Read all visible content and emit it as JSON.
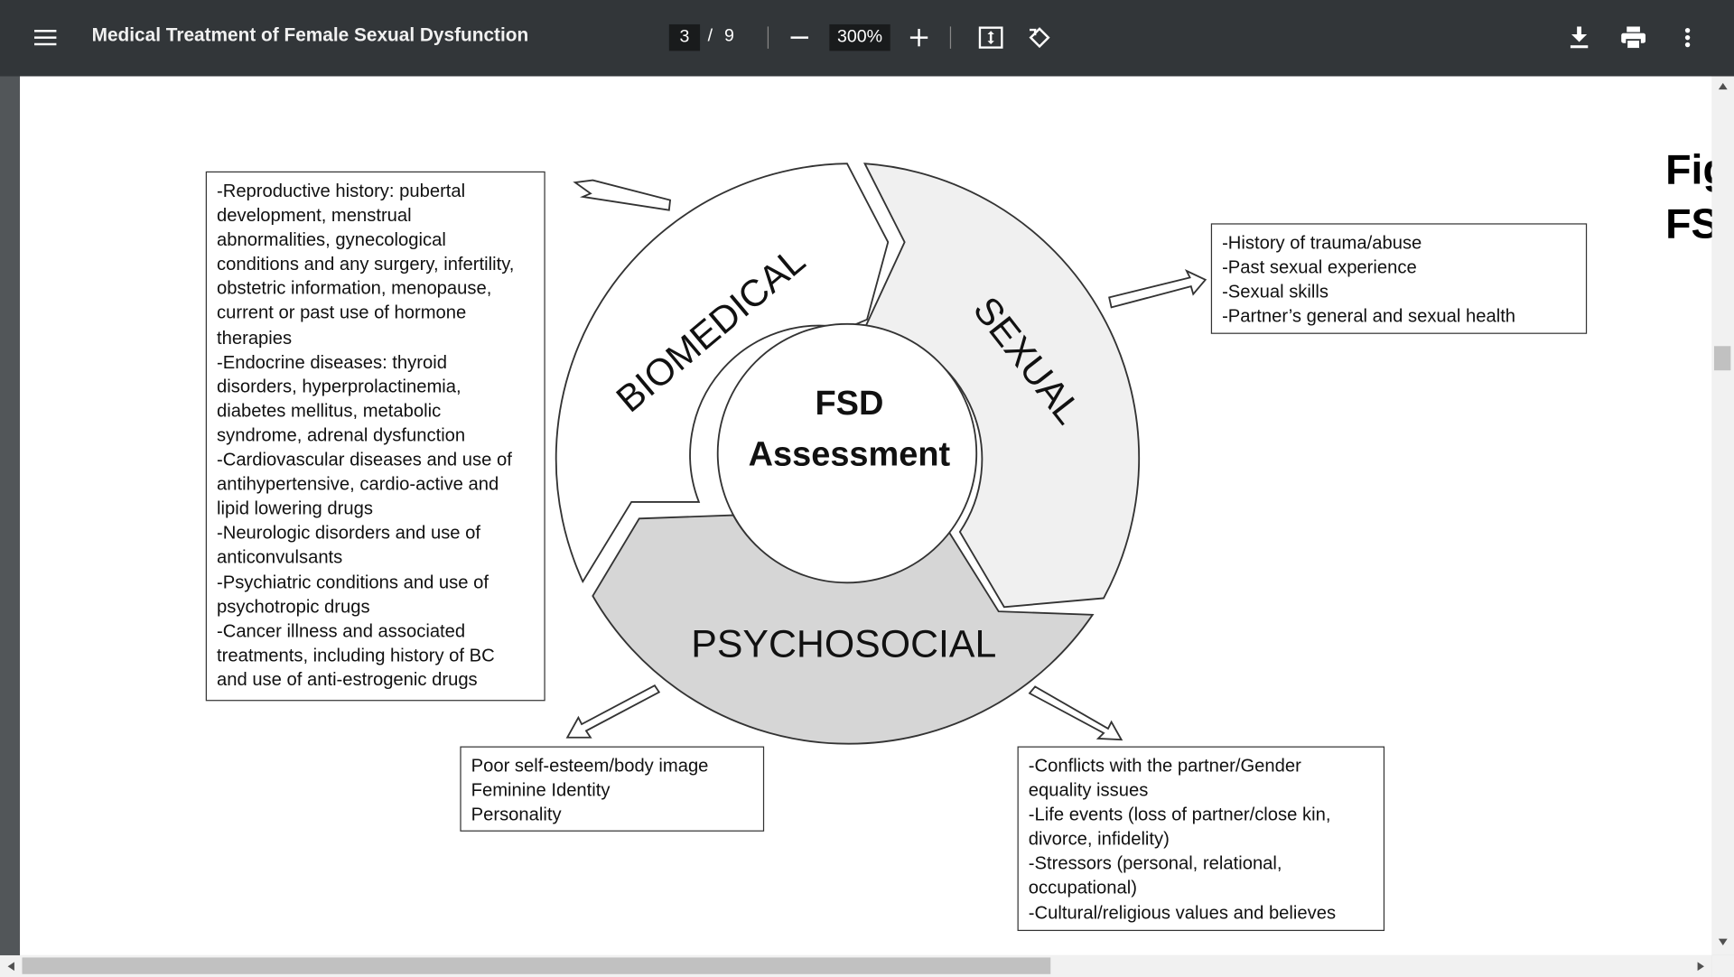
{
  "toolbar": {
    "document_title": "Medical Treatment of Female Sexual Dysfunction",
    "current_page": "3",
    "page_separator": "/",
    "total_pages": "9",
    "zoom_level": "300%",
    "icons": [
      "menu-icon",
      "zoom-out-icon",
      "zoom-in-icon",
      "fit-to-page-icon",
      "rotate-icon",
      "download-icon",
      "print-icon",
      "more-options-icon"
    ]
  },
  "figure": {
    "center_label_line1": "FSD",
    "center_label_line2": "Assessment",
    "segments": {
      "biomedical": "BIOMEDICAL",
      "sexual": "SEXUAL",
      "psychosocial": "PSYCHOSOCIAL"
    },
    "biomedical_box": [
      "-Reproductive history: pubertal",
      "development, menstrual",
      "abnormalities, gynecological",
      "conditions and any surgery, infertility,",
      "obstetric information,  menopause,",
      "current or past use of hormone",
      "therapies",
      "-Endocrine diseases: thyroid",
      "disorders, hyperprolactinemia,",
      "diabetes mellitus, metabolic",
      "syndrome, adrenal dysfunction",
      "-Cardiovascular diseases and use of",
      "antihypertensive, cardio-active and",
      "lipid lowering drugs",
      "-Neurologic disorders and use of",
      "anticonvulsants",
      "-Psychiatric conditions and use of",
      "psychotropic drugs",
      "-Cancer illness and associated",
      "treatments, including history of BC",
      "and  use of anti-estrogenic drugs"
    ],
    "sexual_box": [
      "-History of trauma/abuse",
      "-Past sexual experience",
      "-Sexual skills",
      "-Partner’s general and sexual health"
    ],
    "psychosocial_left_box": [
      "Poor self-esteem/body image",
      "Feminine Identity",
      "Personality"
    ],
    "psychosocial_right_box": [
      "-Conflicts with the partner/Gender",
      "equality issues",
      "-Life events (loss of partner/close kin,",
      "divorce, infidelity)",
      "-Stressors (personal, relational,",
      "occupational)",
      "-Cultural/religious values and believes"
    ],
    "cutoff_caption_line1": "Fig",
    "cutoff_caption_line2": "FS"
  },
  "colors": {
    "toolbar_bg": "#323639",
    "viewer_bg": "#525659",
    "page_bg": "#ffffff",
    "sexual_fill": "#f0f0f0",
    "psychosocial_fill": "#d6d6d6",
    "scrollbar_thumb": "#c1c1c1"
  }
}
